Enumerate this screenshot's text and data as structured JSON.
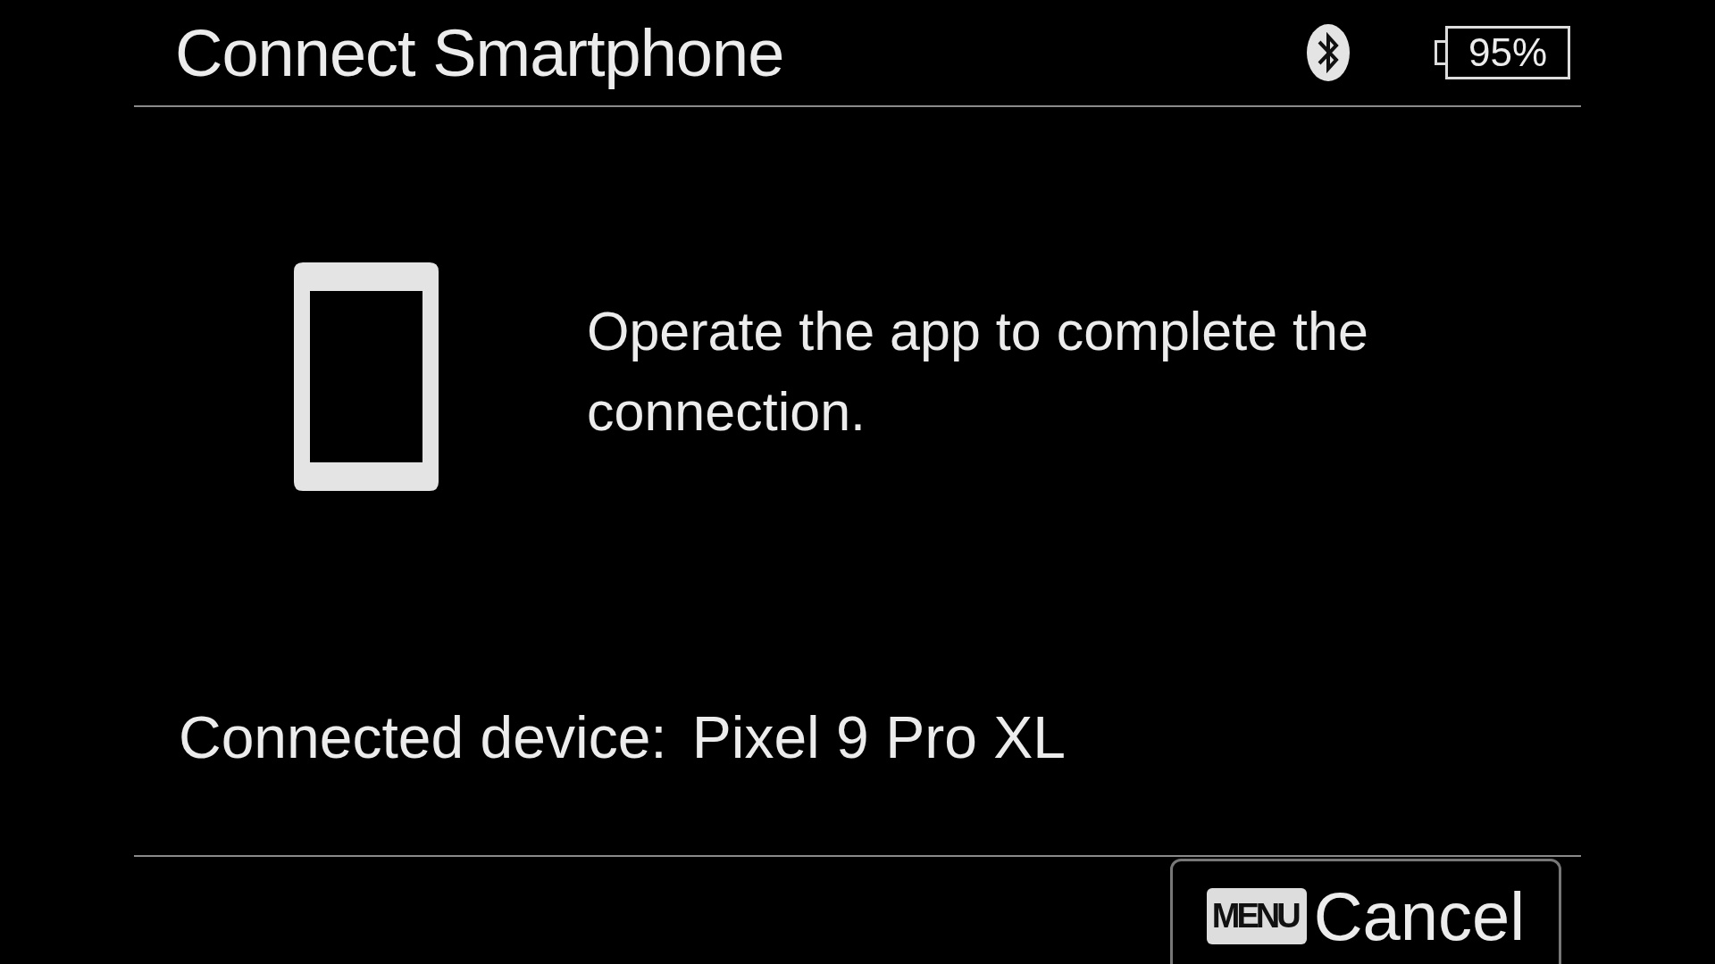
{
  "header": {
    "title": "Connect Smartphone",
    "battery": "95%"
  },
  "message": "Operate the app to complete the connection.",
  "connected_device": {
    "label": "Connected device:",
    "value": "Pixel 9 Pro XL"
  },
  "footer": {
    "button": {
      "key": "MENU",
      "label": "Cancel"
    }
  }
}
